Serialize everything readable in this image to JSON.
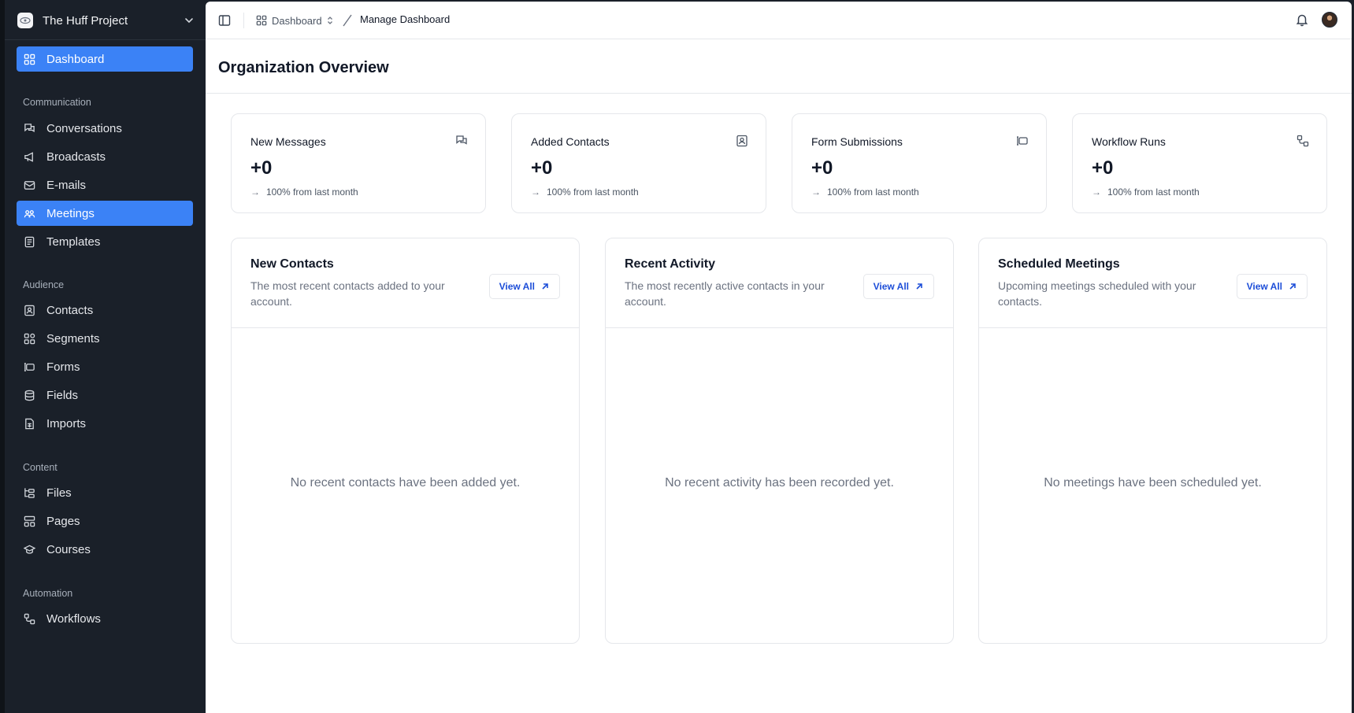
{
  "workspace": {
    "name": "The Huff Project"
  },
  "sidebar": {
    "top_item": {
      "label": "Dashboard"
    },
    "sections": [
      {
        "title": "Communication",
        "items": [
          {
            "label": "Conversations"
          },
          {
            "label": "Broadcasts"
          },
          {
            "label": "E-mails"
          },
          {
            "label": "Meetings"
          },
          {
            "label": "Templates"
          }
        ]
      },
      {
        "title": "Audience",
        "items": [
          {
            "label": "Contacts"
          },
          {
            "label": "Segments"
          },
          {
            "label": "Forms"
          },
          {
            "label": "Fields"
          },
          {
            "label": "Imports"
          }
        ]
      },
      {
        "title": "Content",
        "items": [
          {
            "label": "Files"
          },
          {
            "label": "Pages"
          },
          {
            "label": "Courses"
          }
        ]
      },
      {
        "title": "Automation",
        "items": [
          {
            "label": "Workflows"
          }
        ]
      }
    ],
    "active_items": [
      "Dashboard",
      "Meetings"
    ]
  },
  "topbar": {
    "breadcrumb_parent": "Dashboard",
    "breadcrumb_current": "Manage Dashboard"
  },
  "page": {
    "title": "Organization Overview"
  },
  "stats": [
    {
      "title": "New Messages",
      "value": "+0",
      "change": "100% from last month",
      "icon": "messages-icon"
    },
    {
      "title": "Added Contacts",
      "value": "+0",
      "change": "100% from last month",
      "icon": "contact-icon"
    },
    {
      "title": "Form Submissions",
      "value": "+0",
      "change": "100% from last month",
      "icon": "form-icon"
    },
    {
      "title": "Workflow Runs",
      "value": "+0",
      "change": "100% from last month",
      "icon": "workflow-icon"
    }
  ],
  "panels": [
    {
      "title": "New Contacts",
      "description": "The most recent contacts added to your account.",
      "button": "View All",
      "empty": "No recent contacts have been added yet."
    },
    {
      "title": "Recent Activity",
      "description": "The most recently active contacts in your account.",
      "button": "View All",
      "empty": "No recent activity has been recorded yet."
    },
    {
      "title": "Scheduled Meetings",
      "description": "Upcoming meetings scheduled with your contacts.",
      "button": "View All",
      "empty": "No meetings have been scheduled yet."
    }
  ],
  "colors": {
    "sidebar_bg": "#1a2029",
    "accent": "#3b82f6",
    "link": "#1d4ed8"
  }
}
